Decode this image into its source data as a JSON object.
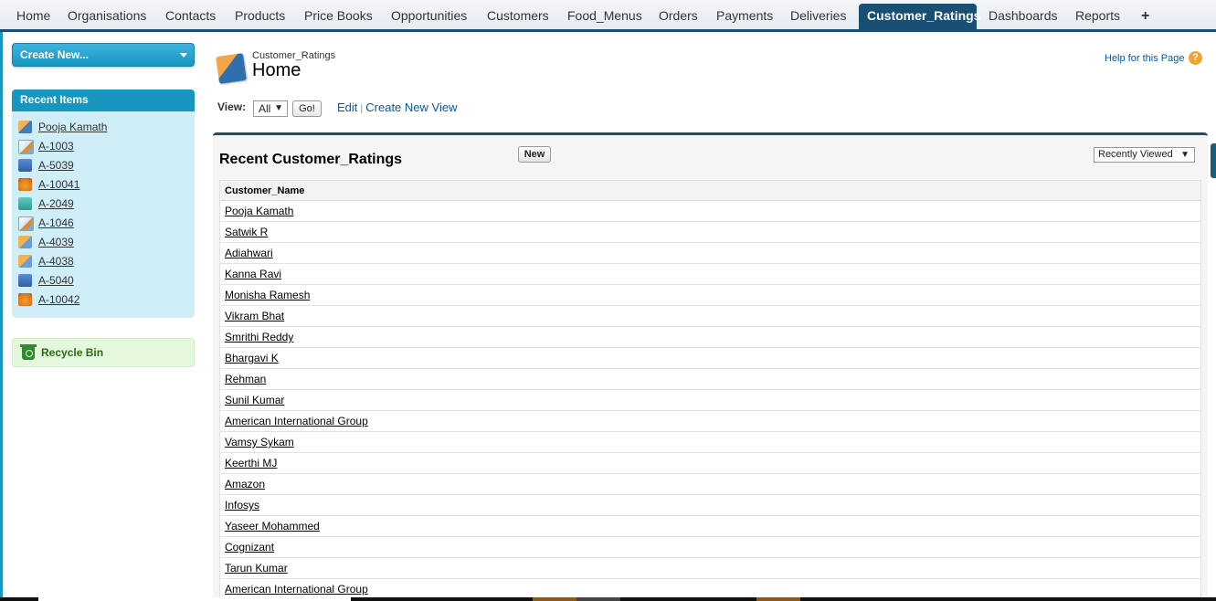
{
  "tabs": [
    {
      "label": "Home"
    },
    {
      "label": "Organisations"
    },
    {
      "label": "Contacts"
    },
    {
      "label": "Products"
    },
    {
      "label": "Price Books"
    },
    {
      "label": "Opportunities"
    },
    {
      "label": "Customers"
    },
    {
      "label": "Food_Menus"
    },
    {
      "label": "Orders"
    },
    {
      "label": "Payments"
    },
    {
      "label": "Deliveries"
    },
    {
      "label": "Customer_Ratings"
    },
    {
      "label": "Dashboards"
    },
    {
      "label": "Reports"
    },
    {
      "label": "+"
    }
  ],
  "active_tab": "Customer_Ratings",
  "sidebar": {
    "create_new_label": "Create New...",
    "recent_items_title": "Recent Items",
    "recent_items": [
      {
        "label": "Pooja Kamath",
        "icon": "rating-icon"
      },
      {
        "label": "A-1003",
        "icon": "pen-icon"
      },
      {
        "label": "A-5039",
        "icon": "book-icon"
      },
      {
        "label": "A-10041",
        "icon": "food-icon"
      },
      {
        "label": "A-2049",
        "icon": "cup-icon"
      },
      {
        "label": "A-1046",
        "icon": "pen-icon"
      },
      {
        "label": "A-4039",
        "icon": "payment-icon"
      },
      {
        "label": "A-4038",
        "icon": "payment-icon"
      },
      {
        "label": "A-5040",
        "icon": "book-icon"
      },
      {
        "label": "A-10042",
        "icon": "food-icon"
      }
    ],
    "recycle_bin_label": "Recycle Bin"
  },
  "page_header": {
    "object_type": "Customer_Ratings",
    "title": "Home",
    "help_label": "Help for this Page",
    "help_icon_glyph": "?"
  },
  "view": {
    "label": "View:",
    "selected": "All",
    "go_label": "Go!",
    "edit_label": "Edit",
    "separator": "|",
    "create_view_label": "Create New View"
  },
  "list": {
    "title": "Recent Customer_Ratings",
    "new_button_label": "New",
    "sort_selected": "Recently Viewed",
    "column_header": "Customer_Name",
    "rows": [
      "Pooja Kamath",
      "Satwik R",
      "Adiahwari",
      "Kanna Ravi",
      "Monisha Ramesh",
      "Vikram Bhat",
      "Smrithi Reddy",
      "Bhargavi K",
      "Rehman",
      "Sunil Kumar",
      "American International Group",
      "Vamsy Sykam",
      "Keerthi MJ",
      "Amazon",
      "Infosys",
      "Yaseer Mohammed",
      "Cognizant",
      "Tarun Kumar",
      "American International Group"
    ]
  },
  "colors": {
    "tab_active_bg": "#1a4f74",
    "sidebar_accent": "#1797c0",
    "recent_bg": "#cfeef8",
    "recycle_bg": "#e3f8dc",
    "link_blue": "#015ba7"
  }
}
